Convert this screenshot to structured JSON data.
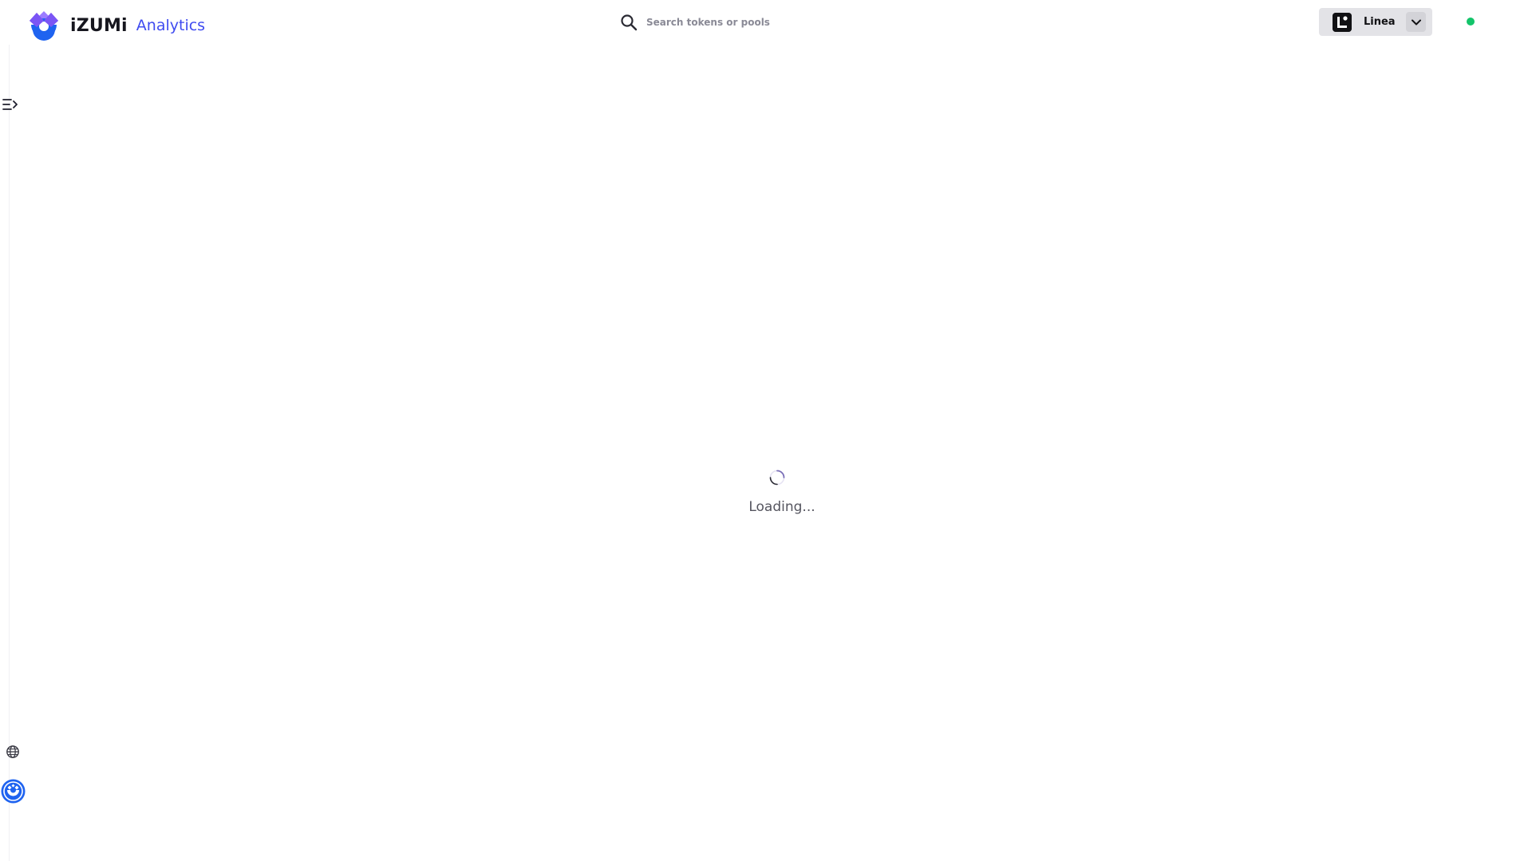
{
  "app": {
    "brand_word": "iZUMi",
    "brand_suffix": "Analytics"
  },
  "search": {
    "placeholder": "Search tokens or pools",
    "value": ""
  },
  "network": {
    "selected": "Linea",
    "status_color": "#13c46a"
  },
  "main": {
    "loading_text": "Loading..."
  },
  "colors": {
    "brand_blue": "#1f63f0",
    "brand_purple": "#7b55f5",
    "accent_text": "#3f4bf0"
  },
  "icons": {
    "logo": "izumi-logo",
    "search": "search-icon",
    "network": "linea-logo",
    "dropdown": "chevron-down-icon",
    "sidebar_toggle": "menu-expand-icon",
    "language": "globe-icon",
    "token_badge": "izi-token-icon",
    "spinner": "spinner-icon"
  }
}
